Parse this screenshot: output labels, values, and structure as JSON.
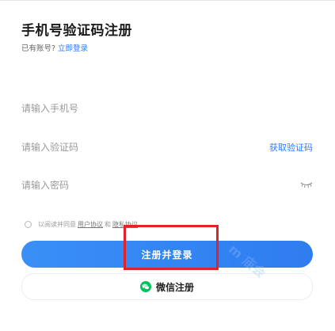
{
  "header": {
    "title": "手机号验证码注册",
    "have_account_text": "已有账号?",
    "login_link": "立即登录"
  },
  "form": {
    "phone_placeholder": "请输入手机号",
    "code_placeholder": "请输入验证码",
    "get_code_label": "获取验证码",
    "password_placeholder": "请输入密码"
  },
  "agreement": {
    "prefix": "以阅读并同意",
    "user_agreement": "用户协议",
    "and": "和",
    "privacy_policy": "隐私协议"
  },
  "buttons": {
    "register_login": "注册并登录",
    "wechat_register": "微信注册"
  },
  "watermark": {
    "text": "m 庙会"
  },
  "colors": {
    "accent": "#2b7cff",
    "highlight": "#e3212a",
    "wechat_green": "#07c160"
  },
  "icons": {
    "eye": "eye-closed-icon",
    "wechat": "wechat-icon",
    "radio": "radio-unchecked-icon"
  }
}
